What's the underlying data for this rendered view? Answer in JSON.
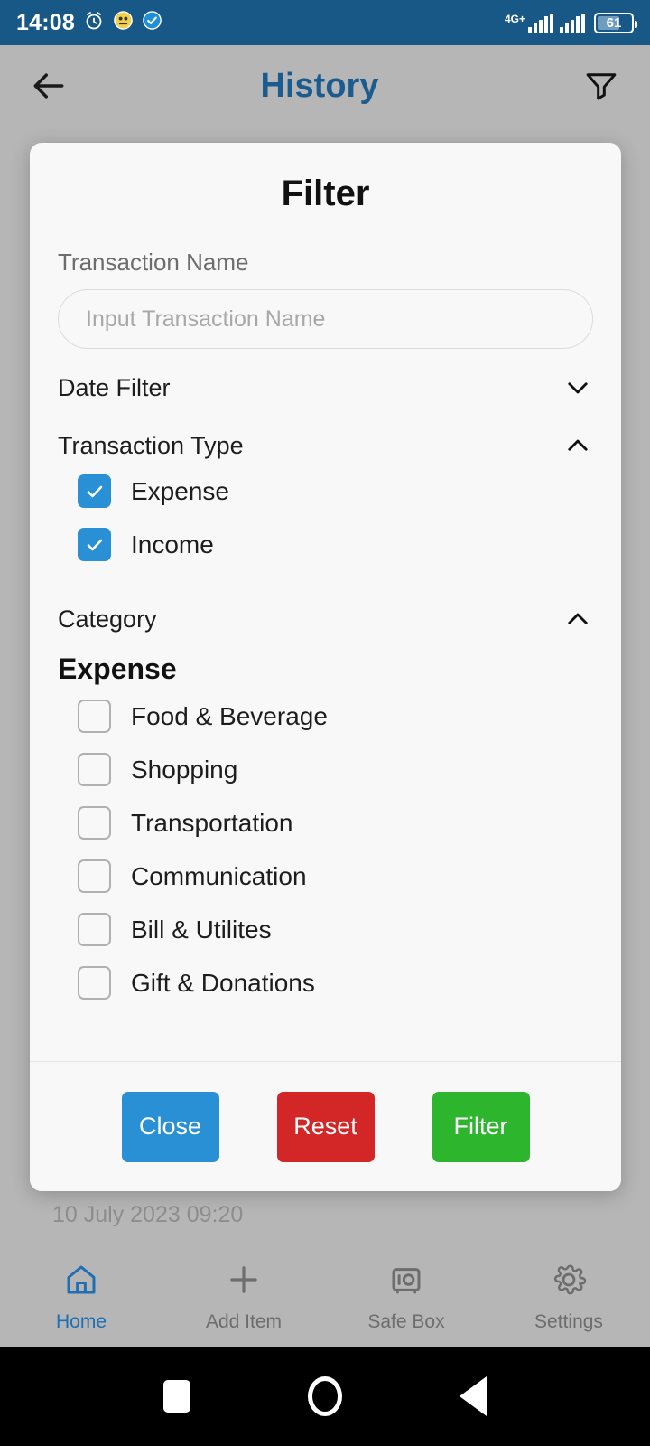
{
  "status_bar": {
    "time": "14:08",
    "network_type": "4G+",
    "battery_percent": "61",
    "icons": [
      "alarm-icon",
      "app-notification-icon",
      "check-badge-icon"
    ]
  },
  "app_bar": {
    "title": "History",
    "back_icon": "back-arrow-icon",
    "filter_icon": "funnel-filter-icon",
    "title_color": "#1a5c8f"
  },
  "background": {
    "date_text": "10 July 2023 09:20"
  },
  "dialog": {
    "title": "Filter",
    "transaction_name": {
      "label": "Transaction Name",
      "placeholder": "Input Transaction Name",
      "value": ""
    },
    "date_filter": {
      "label": "Date Filter",
      "expanded": false,
      "chevron": "chevron-down-icon"
    },
    "transaction_type": {
      "label": "Transaction Type",
      "expanded": true,
      "chevron": "chevron-up-icon",
      "options": [
        {
          "label": "Expense",
          "checked": true
        },
        {
          "label": "Income",
          "checked": true
        }
      ]
    },
    "category": {
      "label": "Category",
      "expanded": true,
      "chevron": "chevron-up-icon",
      "group_heading": "Expense",
      "options": [
        {
          "label": "Food & Beverage",
          "checked": false
        },
        {
          "label": "Shopping",
          "checked": false
        },
        {
          "label": "Transportation",
          "checked": false
        },
        {
          "label": "Communication",
          "checked": false
        },
        {
          "label": "Bill & Utilites",
          "checked": false
        },
        {
          "label": "Gift & Donations",
          "checked": false
        }
      ]
    },
    "footer": {
      "close_label": "Close",
      "reset_label": "Reset",
      "filter_label": "Filter",
      "close_color": "#2a90d6",
      "reset_color": "#d32626",
      "filter_color": "#2eb52e"
    }
  },
  "bottom_nav": {
    "items": [
      {
        "label": "Home",
        "icon": "home-icon",
        "active": true
      },
      {
        "label": "Add Item",
        "icon": "plus-icon",
        "active": false
      },
      {
        "label": "Safe Box",
        "icon": "safe-box-icon",
        "active": false
      },
      {
        "label": "Settings",
        "icon": "gear-icon",
        "active": false
      }
    ],
    "active_color": "#1f6fb2"
  },
  "system_nav": {
    "recent_icon": "square-recents-icon",
    "home_icon": "circle-home-icon",
    "back_icon": "triangle-back-icon"
  }
}
